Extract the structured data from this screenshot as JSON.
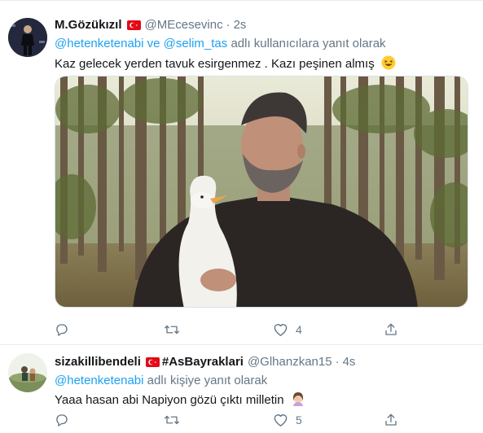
{
  "tweets": [
    {
      "author": {
        "name": "M.Gözükızıl",
        "handle": "@MEcesevinc",
        "time": "2s",
        "flag": "turkey-flag"
      },
      "reply_to": {
        "users": [
          "@hetenketenabi",
          "@selim_tas"
        ],
        "joiner": "ve",
        "suffix": "adlı kullanıcılara yanıt olarak"
      },
      "text": "Kaz gelecek yerden tavuk esirgenmez . Kazı peşinen almış",
      "emoji": "grinning-squinting-face-emoji",
      "media": "photo-man-with-goose-in-forest",
      "actions": {
        "reply_count": "",
        "retweet_count": "",
        "like_count": "4"
      }
    },
    {
      "author": {
        "name": "sizakillibendeli",
        "name_suffix": "#AsBayraklari",
        "handle": "@Glhanzkan15",
        "time": "4s",
        "flag": "turkey-flag"
      },
      "reply_to": {
        "users": [
          "@hetenketenabi"
        ],
        "suffix": "adlı kişiye yanıt olarak"
      },
      "text": "Yaaa hasan abi Napiyon gözü çıktı milletin",
      "emoji": "woman-facepalming-emoji",
      "actions": {
        "reply_count": "",
        "retweet_count": "",
        "like_count": "5"
      }
    }
  ],
  "colors": {
    "accent": "#1da1f2",
    "muted": "#657786",
    "text": "#14171a",
    "flag_red": "#e30a17"
  }
}
